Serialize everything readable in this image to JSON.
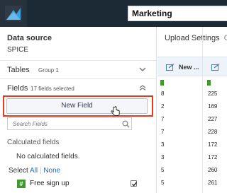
{
  "topbar": {
    "dataset_name": "Marketing",
    "logo_icon": "quicksight-logo-icon"
  },
  "left_panel": {
    "data_source_label": "Data source",
    "data_source_value": "SPICE",
    "tables": {
      "label": "Tables",
      "sub": "Group 1",
      "icon": "chevron-down-icon"
    },
    "fields": {
      "label": "Fields",
      "sub": "17 fields selected",
      "icon": "chevron-up-icon"
    },
    "new_field_button": "New Field",
    "search_placeholder": "Search Fields",
    "calculated_fields_label": "Calculated fields",
    "calculated_fields_empty": "No calculated fields.",
    "select": {
      "label": "Select",
      "all": "All",
      "separator": "|",
      "none": "None"
    },
    "field_items": [
      {
        "type_icon": "#",
        "name": "Free sign up",
        "checked": true
      }
    ]
  },
  "right_panel": {
    "title": "Upload Settings",
    "title_tail": "C",
    "columns": [
      {
        "title": "New ...",
        "icon": "edit-icon"
      },
      {
        "title": "",
        "icon": "edit-icon"
      }
    ],
    "rows": [
      {
        "c1": "8",
        "c2": "225"
      },
      {
        "c1": "2",
        "c2": "169"
      },
      {
        "c1": "7",
        "c2": "227"
      },
      {
        "c1": "7",
        "c2": "228"
      },
      {
        "c1": "3",
        "c2": "172"
      },
      {
        "c1": "3",
        "c2": "172"
      },
      {
        "c1": "5",
        "c2": "260"
      },
      {
        "c1": "5",
        "c2": "261"
      }
    ]
  },
  "colors": {
    "topbar_bg": "#1c2a36",
    "highlight_outline": "#e8391f",
    "link": "#1f6fb5",
    "number_type_badge": "#3f9a2a"
  }
}
